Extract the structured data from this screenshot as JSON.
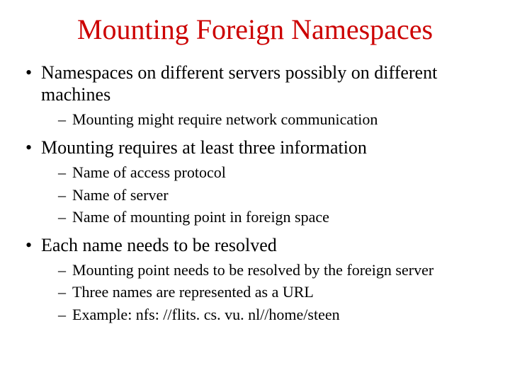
{
  "title": "Mounting Foreign Namespaces",
  "bullets": [
    {
      "text": "Namespaces on different servers possibly on different machines",
      "sub": [
        "Mounting might require network communication"
      ]
    },
    {
      "text": "Mounting requires at least three information",
      "sub": [
        "Name of access protocol",
        "Name of server",
        "Name of mounting point in foreign space"
      ]
    },
    {
      "text": "Each name needs to be resolved",
      "sub": [
        "Mounting point needs to be resolved by the foreign server",
        "Three names are represented as a URL",
        "Example: nfs: //flits. cs. vu. nl//home/steen"
      ]
    }
  ]
}
